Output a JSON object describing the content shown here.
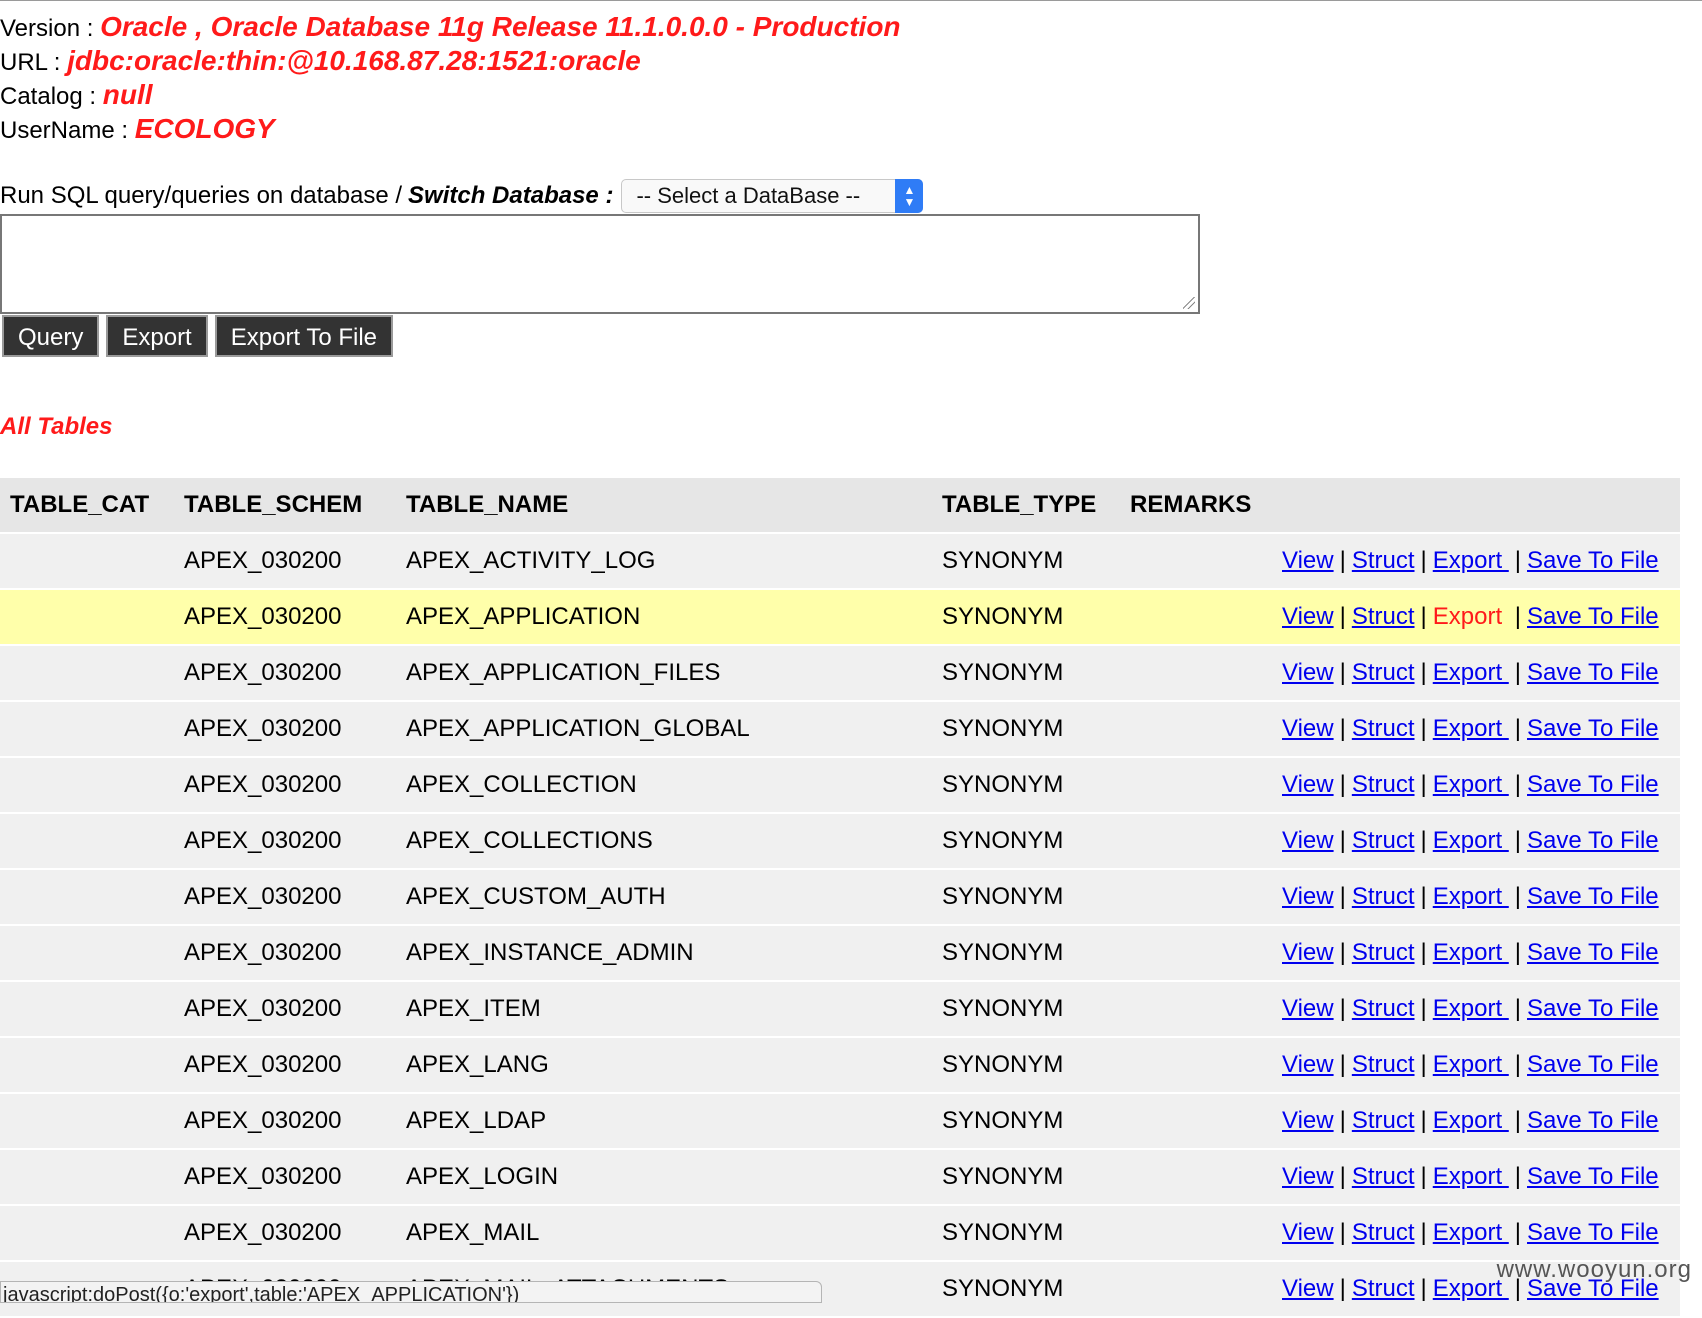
{
  "connection": {
    "version_label": "Version : ",
    "version_value": "Oracle , Oracle Database 11g Release 11.1.0.0.0 - Production",
    "url_label": "URL : ",
    "url_value": "jdbc:oracle:thin:@10.168.87.28:1521:oracle",
    "catalog_label": "Catalog : ",
    "catalog_value": "null",
    "username_label": "UserName : ",
    "username_value": "ECOLOGY"
  },
  "query": {
    "label": "Run SQL query/queries on database / ",
    "switch_label": "Switch Database :",
    "select_value": "-- Select a DataBase --",
    "textarea_value": ""
  },
  "buttons": {
    "query": "Query",
    "export": "Export",
    "export_to_file": "Export To File"
  },
  "section_title": "All Tables",
  "table": {
    "columns": [
      "TABLE_CAT",
      "TABLE_SCHEM",
      "TABLE_NAME",
      "TABLE_TYPE",
      "REMARKS"
    ],
    "actions": [
      "View",
      "Struct",
      "Export ",
      "Save To File"
    ],
    "rows": [
      {
        "cat": "",
        "schem": "APEX_030200",
        "name": "APEX_ACTIVITY_LOG",
        "type": "SYNONYM",
        "remarks": ""
      },
      {
        "cat": "",
        "schem": "APEX_030200",
        "name": "APEX_APPLICATION",
        "type": "SYNONYM",
        "remarks": ""
      },
      {
        "cat": "",
        "schem": "APEX_030200",
        "name": "APEX_APPLICATION_FILES",
        "type": "SYNONYM",
        "remarks": ""
      },
      {
        "cat": "",
        "schem": "APEX_030200",
        "name": "APEX_APPLICATION_GLOBAL",
        "type": "SYNONYM",
        "remarks": ""
      },
      {
        "cat": "",
        "schem": "APEX_030200",
        "name": "APEX_COLLECTION",
        "type": "SYNONYM",
        "remarks": ""
      },
      {
        "cat": "",
        "schem": "APEX_030200",
        "name": "APEX_COLLECTIONS",
        "type": "SYNONYM",
        "remarks": ""
      },
      {
        "cat": "",
        "schem": "APEX_030200",
        "name": "APEX_CUSTOM_AUTH",
        "type": "SYNONYM",
        "remarks": ""
      },
      {
        "cat": "",
        "schem": "APEX_030200",
        "name": "APEX_INSTANCE_ADMIN",
        "type": "SYNONYM",
        "remarks": ""
      },
      {
        "cat": "",
        "schem": "APEX_030200",
        "name": "APEX_ITEM",
        "type": "SYNONYM",
        "remarks": ""
      },
      {
        "cat": "",
        "schem": "APEX_030200",
        "name": "APEX_LANG",
        "type": "SYNONYM",
        "remarks": ""
      },
      {
        "cat": "",
        "schem": "APEX_030200",
        "name": "APEX_LDAP",
        "type": "SYNONYM",
        "remarks": ""
      },
      {
        "cat": "",
        "schem": "APEX_030200",
        "name": "APEX_LOGIN",
        "type": "SYNONYM",
        "remarks": ""
      },
      {
        "cat": "",
        "schem": "APEX_030200",
        "name": "APEX_MAIL",
        "type": "SYNONYM",
        "remarks": ""
      },
      {
        "cat": "",
        "schem": "APEX_030200",
        "name": "APEX_MAIL_ATTACHMENTS",
        "type": "SYNONYM",
        "remarks": ""
      }
    ],
    "highlighted_row": 1,
    "hovered_action": "Export "
  },
  "status_bar": {
    "link_preview": "javascript:doPost({o:'export',table:'APEX_APPLICATION'})"
  },
  "watermark": "www.wooyun.org",
  "colors": {
    "accent_red": "#ff1a1a",
    "link_blue": "#0000ee",
    "row_bg": "#f0f0f0",
    "header_bg": "#e6e6e6",
    "highlight_bg": "#ffffaa",
    "button_bg": "#333333"
  }
}
